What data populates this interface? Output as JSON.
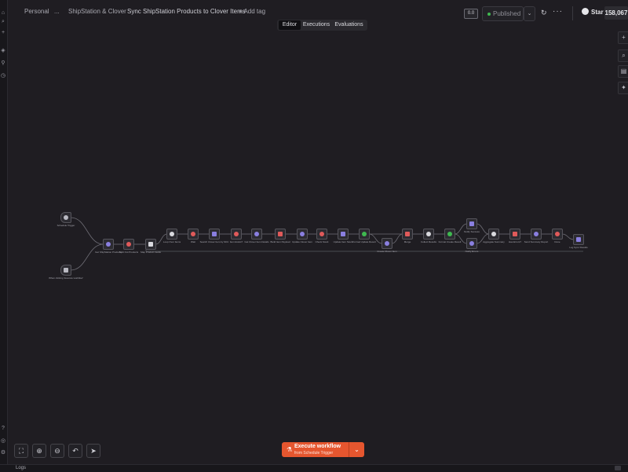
{
  "header": {
    "project": "Personal",
    "ellipsis": "...",
    "folder": "ShipStation & Clover",
    "workflow_title": "Sync ShipStation Products to Clover Items",
    "add_tag": "+ Add tag",
    "version_badge": "0.0",
    "publish_label": "Published",
    "more": "···",
    "github_label": "Star",
    "github_count": "158,067"
  },
  "tabs": [
    {
      "label": "Editor",
      "active": true
    },
    {
      "label": "Executions",
      "active": false
    },
    {
      "label": "Evaluations",
      "active": false
    }
  ],
  "workflow": {
    "nodes": [
      {
        "id": "n1",
        "label": "Schedule Trigger",
        "icon_color": "#b9b9c2",
        "trigger": true
      },
      {
        "id": "n2",
        "label": "When clicking 'Execute workflow'",
        "icon_color": "#b9b9c2",
        "trigger": true
      },
      {
        "id": "n3",
        "label": "Get ShipStation Products",
        "icon_color": "#8a7fe0"
      },
      {
        "id": "n4",
        "label": "Split Out Products",
        "icon_color": "#e05a5a"
      },
      {
        "id": "n5",
        "label": "Map Product Fields",
        "icon_color": "#d9d9de"
      },
      {
        "id": "n6",
        "label": "Loop Over Items",
        "icon_color": "#d9d9de"
      },
      {
        "id": "n7",
        "label": "Wait",
        "icon_color": "#e05a5a"
      },
      {
        "id": "n8",
        "label": "Search Clover Item by SKU",
        "icon_color": "#8a7fe0"
      },
      {
        "id": "n9",
        "label": "Item Exists?",
        "icon_color": "#e05a5a"
      },
      {
        "id": "n10",
        "label": "Get Clover Item Details",
        "icon_color": "#8a7fe0"
      },
      {
        "id": "n11",
        "label": "Build Item Payload",
        "icon_color": "#e05a5a"
      },
      {
        "id": "n12",
        "label": "Update Clover Item",
        "icon_color": "#8a7fe0"
      },
      {
        "id": "n13",
        "label": "Check Stock",
        "icon_color": "#e05a5a"
      },
      {
        "id": "n14",
        "label": "Update Item Stock",
        "icon_color": "#8a7fe0"
      },
      {
        "id": "n15",
        "label": "Format Update Result",
        "icon_color": "#3fb950"
      },
      {
        "id": "n16",
        "label": "Create Clover Item",
        "icon_color": "#8a7fe0"
      },
      {
        "id": "n17",
        "label": "Merge",
        "icon_color": "#e05a5a"
      },
      {
        "id": "n18",
        "label": "Collect Results",
        "icon_color": "#d9d9de"
      },
      {
        "id": "n19",
        "label": "Format Create Result",
        "icon_color": "#3fb950"
      },
      {
        "id": "n20",
        "label": "Notify Success",
        "icon_color": "#8a7fe0"
      },
      {
        "id": "n21",
        "label": "Notify Errors",
        "icon_color": "#8a7fe0"
      },
      {
        "id": "n22",
        "label": "Aggregate Summary",
        "icon_color": "#d9d9de"
      },
      {
        "id": "n23",
        "label": "Has Errors?",
        "icon_color": "#e05a5a"
      },
      {
        "id": "n24",
        "label": "Send Summary Report",
        "icon_color": "#8a7fe0"
      },
      {
        "id": "n25",
        "label": "Done",
        "icon_color": "#e05a5a"
      },
      {
        "id": "n26",
        "label": "Log Sync Results",
        "icon_color": "#8a7fe0"
      }
    ]
  },
  "execute": {
    "label": "Execute workflow",
    "sublabel": "from Schedule Trigger"
  },
  "bottom": {
    "logs": "Logs"
  },
  "icons": {
    "left": [
      "home-icon",
      "search-icon",
      "plus-icon",
      "workflow-icon",
      "key-icon",
      "history-icon"
    ],
    "right": [
      "plus-icon",
      "search-icon",
      "document-icon",
      "sparkle-icon"
    ],
    "zoom": [
      "fit-view-icon",
      "zoom-in-icon",
      "zoom-out-icon",
      "undo-icon",
      "pointer-icon"
    ]
  }
}
